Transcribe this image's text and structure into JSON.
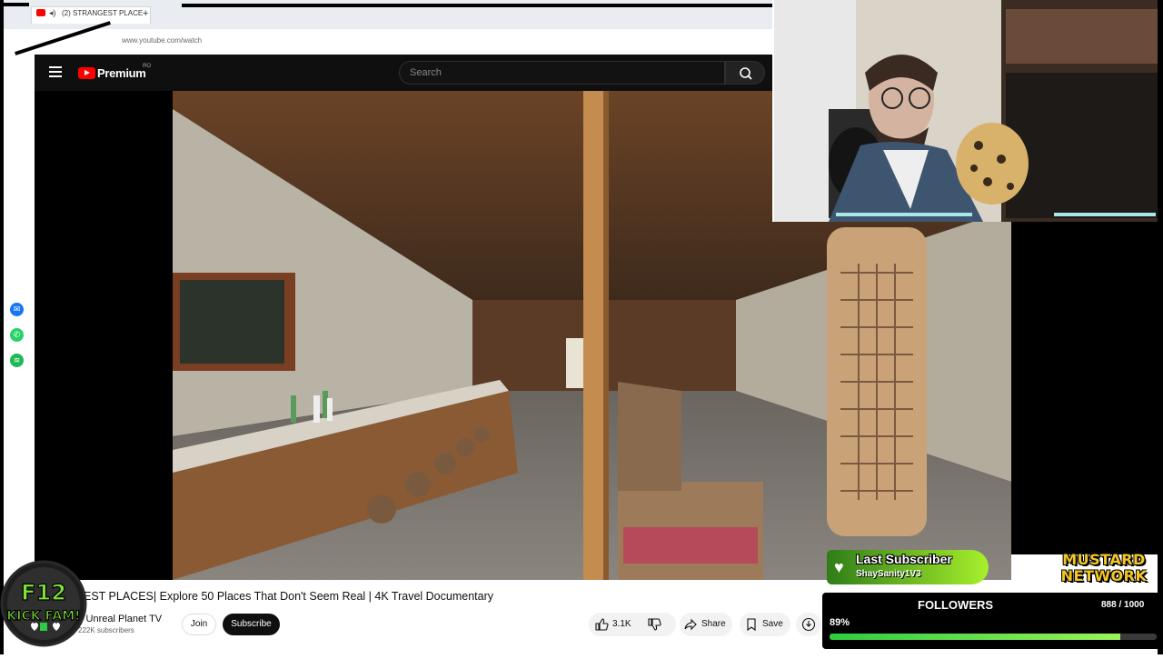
{
  "browser": {
    "tab_title": "(2) STRANGEST PLACE",
    "url": "www.youtube.com/watch"
  },
  "youtube": {
    "logo_text": "Premium",
    "region": "RO",
    "search_placeholder": "Search"
  },
  "video": {
    "title": "EST PLACES| Explore 50 Places That Don't Seem Real | 4K Travel Documentary",
    "channel": "y Unreal Planet TV",
    "subscribers": "222K subscribers",
    "join_label": "Join",
    "subscribe_label": "Subscribe",
    "likes": "3.1K",
    "share_label": "Share",
    "save_label": "Save"
  },
  "overlay": {
    "badge_line1": "F12",
    "badge_line2": "KICK FAM!",
    "last_subscriber_title": "Last Subscriber",
    "last_subscriber_name": "ShaySanity1V3",
    "network_line1": "MUSTARD",
    "network_line2": "NETWORK",
    "followers_title": "FOLLOWERS",
    "followers_count": "888 / 1000",
    "followers_pct_label": "89%",
    "followers_progress": 0.89
  },
  "icons": {
    "messenger": "messenger-icon",
    "whatsapp": "whatsapp-icon",
    "spotify": "spotify-icon"
  },
  "colors": {
    "youtube_red": "#ff0000",
    "accent_green": "#9bf25a",
    "mustard": "#f3c623"
  }
}
